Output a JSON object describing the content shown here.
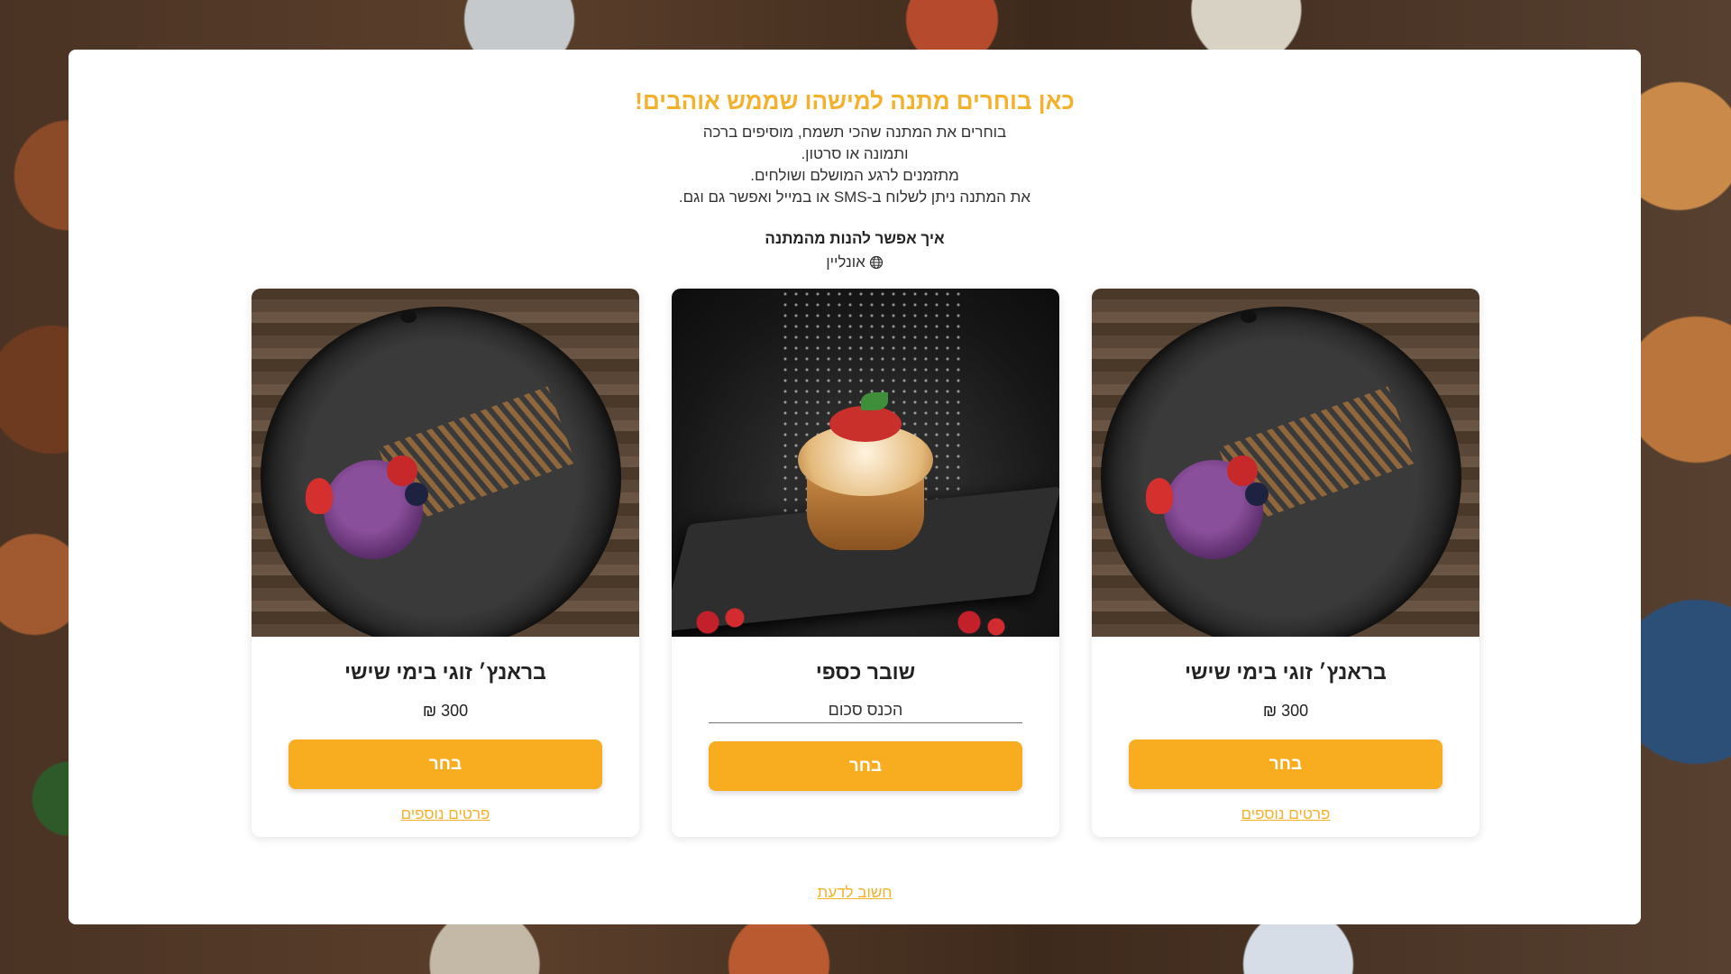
{
  "intro": {
    "headline": "כאן בוחרים מתנה למישהו שממש אוהבים!",
    "lines": [
      "בוחרים את המתנה שהכי תשמח, מוסיפים ברכה",
      "ותמונה או סרטון.",
      "מתזמנים לרגע המושלם ושולחים.",
      "את המתנה ניתן לשלוח ב-SMS או במייל ואפשר גם וגם."
    ],
    "how_title": "איך אפשר להנות מהמתנה",
    "how_item": "אונליין",
    "how_icon": "globe-icon"
  },
  "cards": [
    {
      "title": "בראנץ׳ זוגי בימי שישי",
      "price": "300 ₪",
      "button": "בחר",
      "more": "פרטים נוספים"
    },
    {
      "title": "שובר כספי",
      "input_placeholder": "הכנס סכום",
      "button": "בחר"
    },
    {
      "title": "בראנץ׳ זוגי בימי שישי",
      "price": "300 ₪",
      "button": "בחר",
      "more": "פרטים נוספים"
    }
  ],
  "footer": {
    "link": "חשוב לדעת"
  },
  "colors": {
    "accent": "#f8ac1f",
    "headline": "#f4b12b"
  }
}
